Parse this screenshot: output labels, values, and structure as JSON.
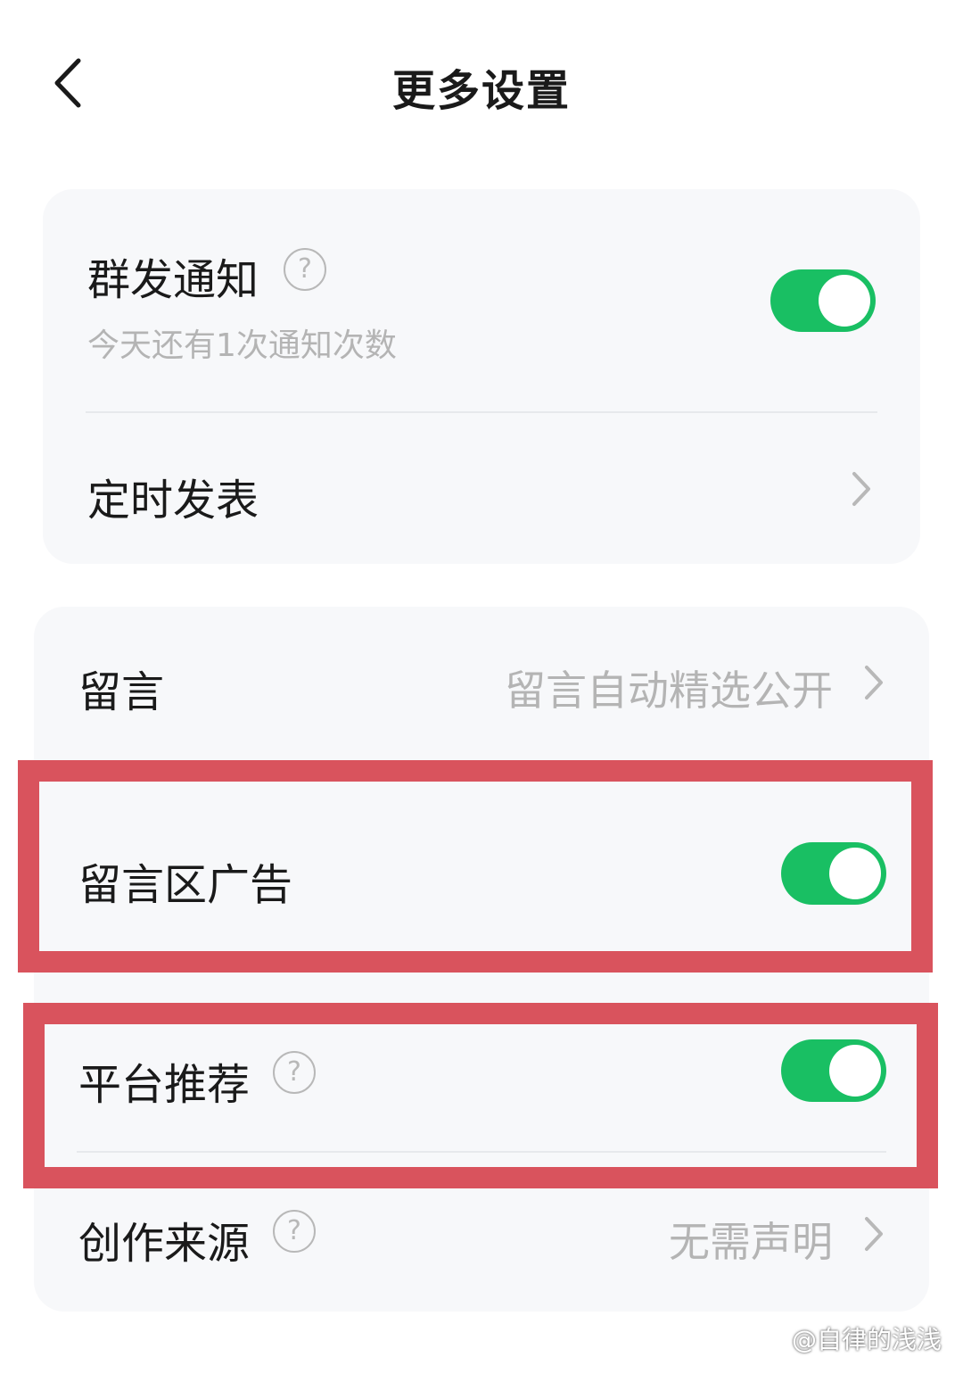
{
  "header": {
    "title": "更多设置"
  },
  "card1": {
    "mass_notify": {
      "label": "群发通知",
      "subtitle": "今天还有1次通知次数",
      "help_glyph": "?",
      "enabled": true
    },
    "scheduled_post": {
      "label": "定时发表"
    }
  },
  "card2": {
    "comments": {
      "label": "留言",
      "value": "留言自动精选公开"
    },
    "comment_ads": {
      "label": "留言区广告",
      "enabled": true
    },
    "platform_recommend": {
      "label": "平台推荐",
      "help_glyph": "?",
      "enabled": true
    },
    "creation_source": {
      "label": "创作来源",
      "help_glyph": "?",
      "value": "无需声明"
    }
  },
  "colors": {
    "accent": "#19bf63",
    "highlight": "#d9535d",
    "card_bg": "#f7f8fa"
  },
  "watermark": "@自律的浅浅"
}
